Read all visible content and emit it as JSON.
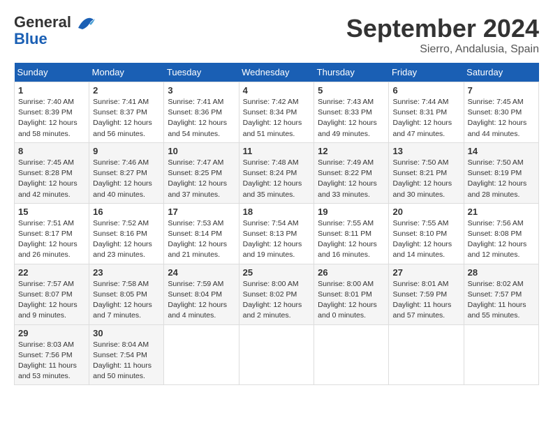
{
  "header": {
    "logo_line1": "General",
    "logo_line2": "Blue",
    "month": "September 2024",
    "location": "Sierro, Andalusia, Spain"
  },
  "weekdays": [
    "Sunday",
    "Monday",
    "Tuesday",
    "Wednesday",
    "Thursday",
    "Friday",
    "Saturday"
  ],
  "weeks": [
    [
      {
        "day": "1",
        "sunrise": "Sunrise: 7:40 AM",
        "sunset": "Sunset: 8:39 PM",
        "daylight": "Daylight: 12 hours and 58 minutes."
      },
      {
        "day": "2",
        "sunrise": "Sunrise: 7:41 AM",
        "sunset": "Sunset: 8:37 PM",
        "daylight": "Daylight: 12 hours and 56 minutes."
      },
      {
        "day": "3",
        "sunrise": "Sunrise: 7:41 AM",
        "sunset": "Sunset: 8:36 PM",
        "daylight": "Daylight: 12 hours and 54 minutes."
      },
      {
        "day": "4",
        "sunrise": "Sunrise: 7:42 AM",
        "sunset": "Sunset: 8:34 PM",
        "daylight": "Daylight: 12 hours and 51 minutes."
      },
      {
        "day": "5",
        "sunrise": "Sunrise: 7:43 AM",
        "sunset": "Sunset: 8:33 PM",
        "daylight": "Daylight: 12 hours and 49 minutes."
      },
      {
        "day": "6",
        "sunrise": "Sunrise: 7:44 AM",
        "sunset": "Sunset: 8:31 PM",
        "daylight": "Daylight: 12 hours and 47 minutes."
      },
      {
        "day": "7",
        "sunrise": "Sunrise: 7:45 AM",
        "sunset": "Sunset: 8:30 PM",
        "daylight": "Daylight: 12 hours and 44 minutes."
      }
    ],
    [
      {
        "day": "8",
        "sunrise": "Sunrise: 7:45 AM",
        "sunset": "Sunset: 8:28 PM",
        "daylight": "Daylight: 12 hours and 42 minutes."
      },
      {
        "day": "9",
        "sunrise": "Sunrise: 7:46 AM",
        "sunset": "Sunset: 8:27 PM",
        "daylight": "Daylight: 12 hours and 40 minutes."
      },
      {
        "day": "10",
        "sunrise": "Sunrise: 7:47 AM",
        "sunset": "Sunset: 8:25 PM",
        "daylight": "Daylight: 12 hours and 37 minutes."
      },
      {
        "day": "11",
        "sunrise": "Sunrise: 7:48 AM",
        "sunset": "Sunset: 8:24 PM",
        "daylight": "Daylight: 12 hours and 35 minutes."
      },
      {
        "day": "12",
        "sunrise": "Sunrise: 7:49 AM",
        "sunset": "Sunset: 8:22 PM",
        "daylight": "Daylight: 12 hours and 33 minutes."
      },
      {
        "day": "13",
        "sunrise": "Sunrise: 7:50 AM",
        "sunset": "Sunset: 8:21 PM",
        "daylight": "Daylight: 12 hours and 30 minutes."
      },
      {
        "day": "14",
        "sunrise": "Sunrise: 7:50 AM",
        "sunset": "Sunset: 8:19 PM",
        "daylight": "Daylight: 12 hours and 28 minutes."
      }
    ],
    [
      {
        "day": "15",
        "sunrise": "Sunrise: 7:51 AM",
        "sunset": "Sunset: 8:17 PM",
        "daylight": "Daylight: 12 hours and 26 minutes."
      },
      {
        "day": "16",
        "sunrise": "Sunrise: 7:52 AM",
        "sunset": "Sunset: 8:16 PM",
        "daylight": "Daylight: 12 hours and 23 minutes."
      },
      {
        "day": "17",
        "sunrise": "Sunrise: 7:53 AM",
        "sunset": "Sunset: 8:14 PM",
        "daylight": "Daylight: 12 hours and 21 minutes."
      },
      {
        "day": "18",
        "sunrise": "Sunrise: 7:54 AM",
        "sunset": "Sunset: 8:13 PM",
        "daylight": "Daylight: 12 hours and 19 minutes."
      },
      {
        "day": "19",
        "sunrise": "Sunrise: 7:55 AM",
        "sunset": "Sunset: 8:11 PM",
        "daylight": "Daylight: 12 hours and 16 minutes."
      },
      {
        "day": "20",
        "sunrise": "Sunrise: 7:55 AM",
        "sunset": "Sunset: 8:10 PM",
        "daylight": "Daylight: 12 hours and 14 minutes."
      },
      {
        "day": "21",
        "sunrise": "Sunrise: 7:56 AM",
        "sunset": "Sunset: 8:08 PM",
        "daylight": "Daylight: 12 hours and 12 minutes."
      }
    ],
    [
      {
        "day": "22",
        "sunrise": "Sunrise: 7:57 AM",
        "sunset": "Sunset: 8:07 PM",
        "daylight": "Daylight: 12 hours and 9 minutes."
      },
      {
        "day": "23",
        "sunrise": "Sunrise: 7:58 AM",
        "sunset": "Sunset: 8:05 PM",
        "daylight": "Daylight: 12 hours and 7 minutes."
      },
      {
        "day": "24",
        "sunrise": "Sunrise: 7:59 AM",
        "sunset": "Sunset: 8:04 PM",
        "daylight": "Daylight: 12 hours and 4 minutes."
      },
      {
        "day": "25",
        "sunrise": "Sunrise: 8:00 AM",
        "sunset": "Sunset: 8:02 PM",
        "daylight": "Daylight: 12 hours and 2 minutes."
      },
      {
        "day": "26",
        "sunrise": "Sunrise: 8:00 AM",
        "sunset": "Sunset: 8:01 PM",
        "daylight": "Daylight: 12 hours and 0 minutes."
      },
      {
        "day": "27",
        "sunrise": "Sunrise: 8:01 AM",
        "sunset": "Sunset: 7:59 PM",
        "daylight": "Daylight: 11 hours and 57 minutes."
      },
      {
        "day": "28",
        "sunrise": "Sunrise: 8:02 AM",
        "sunset": "Sunset: 7:57 PM",
        "daylight": "Daylight: 11 hours and 55 minutes."
      }
    ],
    [
      {
        "day": "29",
        "sunrise": "Sunrise: 8:03 AM",
        "sunset": "Sunset: 7:56 PM",
        "daylight": "Daylight: 11 hours and 53 minutes."
      },
      {
        "day": "30",
        "sunrise": "Sunrise: 8:04 AM",
        "sunset": "Sunset: 7:54 PM",
        "daylight": "Daylight: 11 hours and 50 minutes."
      },
      null,
      null,
      null,
      null,
      null
    ]
  ]
}
